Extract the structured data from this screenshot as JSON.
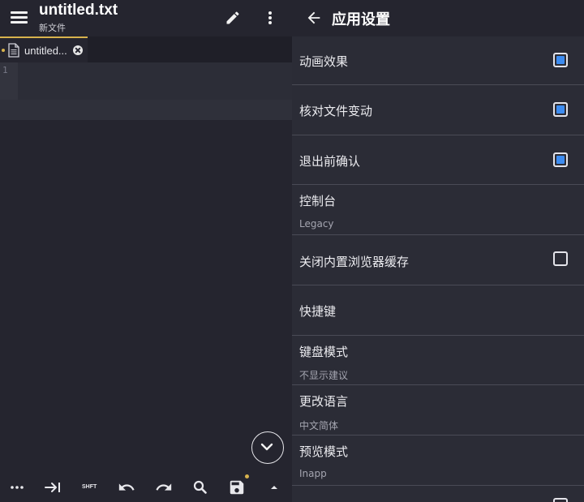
{
  "editor": {
    "title": "untitled.txt",
    "subtitle": "新文件",
    "tab": {
      "label": "untitled..."
    },
    "line_number": "1",
    "bottom_bar": {
      "shift_label": "SHFT"
    }
  },
  "settings": {
    "title": "应用设置",
    "items": [
      {
        "label": "动画效果",
        "checkbox": true
      },
      {
        "label": "核对文件变动",
        "checkbox": true
      },
      {
        "label": "退出前确认",
        "checkbox": true
      },
      {
        "label": "控制台",
        "value": "Legacy"
      },
      {
        "label": "关闭内置浏览器缓存",
        "checkbox": false
      },
      {
        "label": "快捷键"
      },
      {
        "label": "键盘模式",
        "value": "不显示建议"
      },
      {
        "label": "更改语言",
        "value": "中文简体"
      },
      {
        "label": "预览模式",
        "value": "Inapp"
      }
    ]
  },
  "colors": {
    "accent_checkbox": "#3d8cf0",
    "modified_indicator": "#d7b24d",
    "background": "#25252f"
  }
}
